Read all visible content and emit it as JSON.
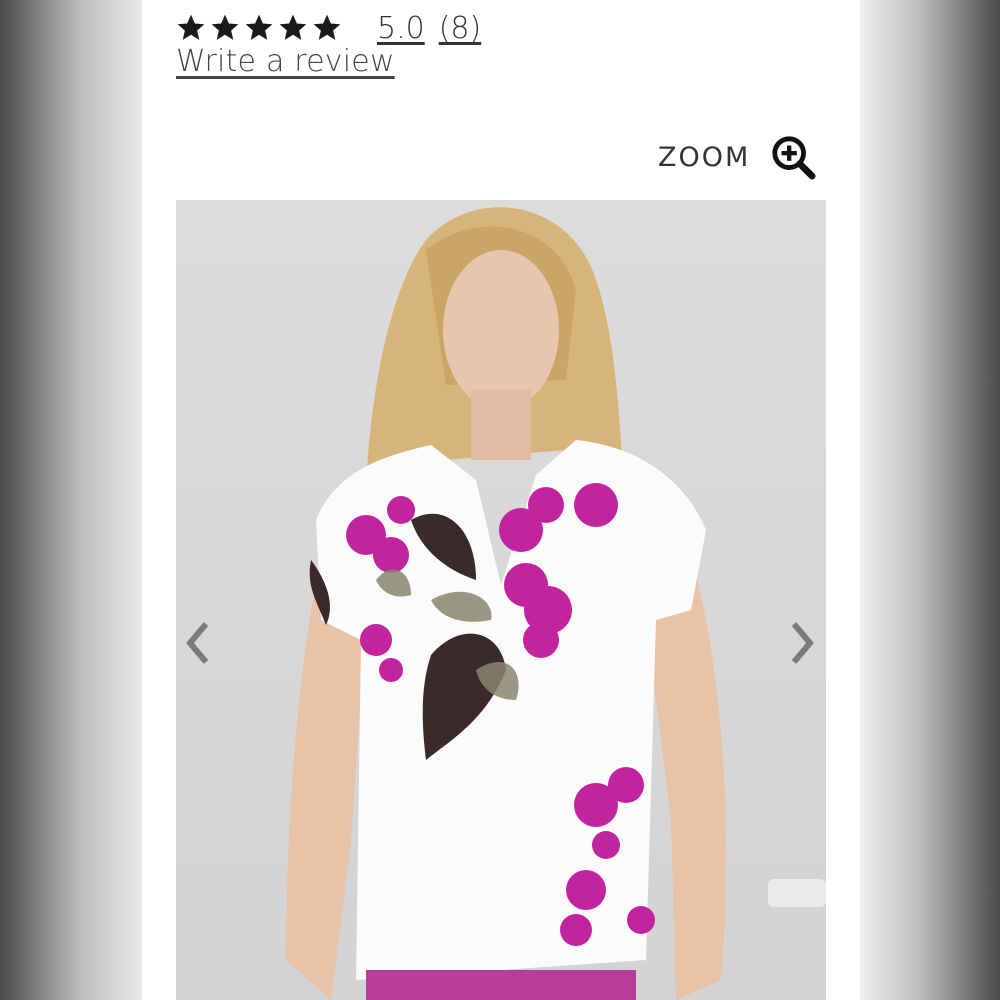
{
  "rating": {
    "stars": 5,
    "value": "5.0",
    "count": "(8)"
  },
  "review_link": "Write a review",
  "zoom": {
    "label": "ZOOM",
    "icon": "zoom-in-icon"
  },
  "gallery": {
    "image_desc_icon": "product-photo",
    "prev_icon": "chevron-left-icon",
    "next_icon": "chevron-right-icon"
  },
  "colors": {
    "accent": "#c2249f",
    "text": "#333333",
    "panel": "#ffffff"
  }
}
